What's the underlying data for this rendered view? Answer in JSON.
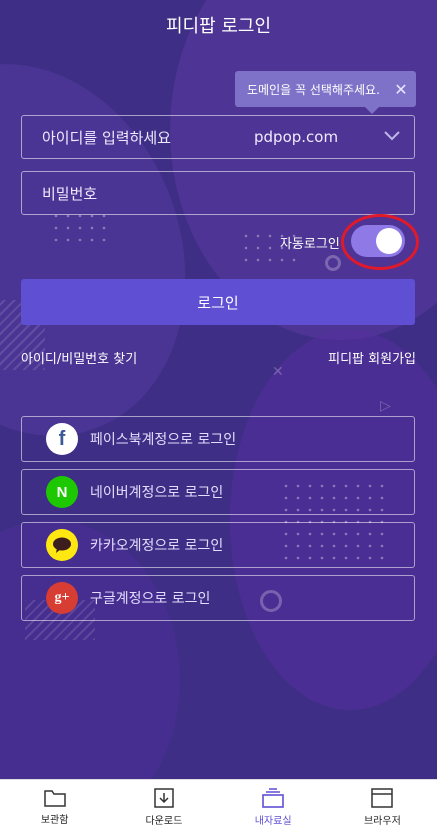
{
  "header": {
    "title": "피디팝 로그인"
  },
  "tooltip": {
    "text": "도메인을 꼭 선택해주세요.",
    "close": "✕"
  },
  "login_form": {
    "id_placeholder": "아이디를 입력하세요",
    "domain": "pdpop.com",
    "domain_chevron": "chevron-down-icon",
    "password_placeholder": "비밀번호",
    "auto_login_label": "자동로그인",
    "auto_login_on": true,
    "login_button": "로그인"
  },
  "links": {
    "find_account": "아이디/비밀번호 찾기",
    "signup": "피디팝 회원가입"
  },
  "social": [
    {
      "label": "페이스북계정으로 로그인",
      "icon": "facebook-icon",
      "glyph": "f",
      "bg": "#ffffff",
      "fg": "#3b5998"
    },
    {
      "label": "네이버계정으로 로그인",
      "icon": "naver-icon",
      "glyph": "N",
      "bg": "#1ec800",
      "fg": "#ffffff"
    },
    {
      "label": "카카오계정으로 로그인",
      "icon": "kakao-icon",
      "glyph": "",
      "bg": "#ffe812",
      "fg": "#3c1e1e"
    },
    {
      "label": "구글계정으로 로그인",
      "icon": "google-plus-icon",
      "glyph": "g+",
      "bg": "#d73d32",
      "fg": "#ffffff"
    }
  ],
  "tabbar": [
    {
      "label": "보관함",
      "icon": "folder-icon",
      "active": false
    },
    {
      "label": "다운로드",
      "icon": "download-icon",
      "active": false
    },
    {
      "label": "내자료실",
      "icon": "library-icon",
      "active": true
    },
    {
      "label": "브라우저",
      "icon": "browser-icon",
      "active": false
    }
  ],
  "colors": {
    "background": "#3f2e85",
    "accent": "#5e4fd3",
    "toggle": "#8e79e6",
    "highlight": "#e0192b"
  }
}
